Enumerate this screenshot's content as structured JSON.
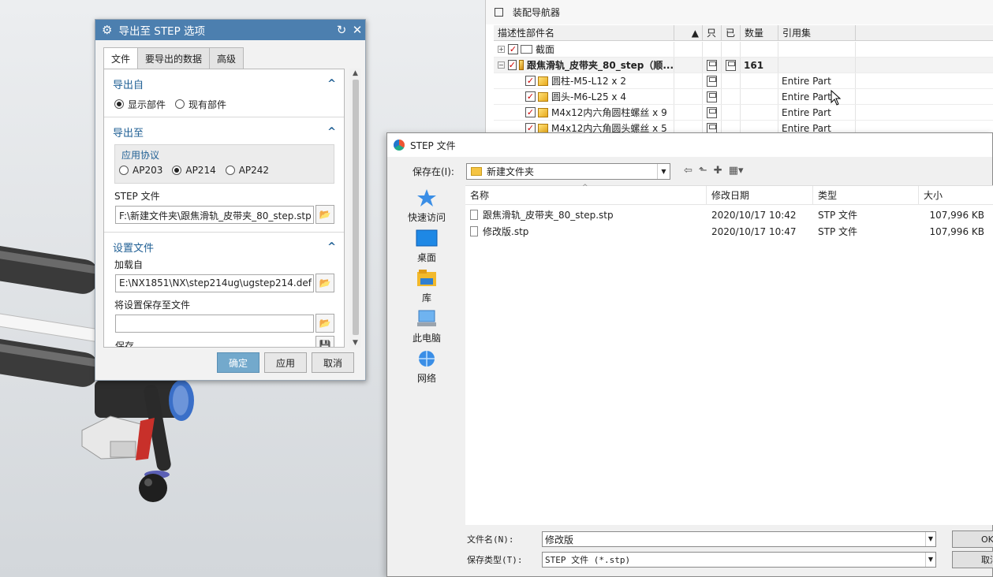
{
  "export_dialog": {
    "title": "导出至 STEP 选项",
    "tabs": [
      "文件",
      "要导出的数据",
      "高级"
    ],
    "export_from": {
      "label": "导出自",
      "options": [
        "显示部件",
        "现有部件"
      ],
      "selected": "显示部件"
    },
    "export_to": {
      "label": "导出至",
      "protocol_label": "应用协议",
      "protocols": [
        "AP203",
        "AP214",
        "AP242"
      ],
      "selected_protocol": "AP214",
      "step_file_label": "STEP 文件",
      "step_file_value": "F:\\新建文件夹\\跟焦滑轨_皮带夹_80_step.stp"
    },
    "settings": {
      "label": "设置文件",
      "load_from_label": "加载自",
      "load_from_value": "E:\\NX1851\\NX\\step214ug\\ugstep214.def",
      "save_to_label": "将设置保存至文件",
      "save_to_value": "",
      "save_label": "保存"
    },
    "buttons": {
      "ok": "确定",
      "apply": "应用",
      "cancel": "取消"
    }
  },
  "assembly_navigator": {
    "title": "装配导航器",
    "columns": [
      "描述性部件名",
      "只",
      "已",
      "数量",
      "引用集"
    ],
    "rows": [
      {
        "name": "截面",
        "qty": "",
        "ref": ""
      },
      {
        "name": "跟焦滑轨_皮带夹_80_step（顺...",
        "qty": "161",
        "ref": ""
      },
      {
        "name": "圆柱-M5-L12 x 2",
        "qty": "",
        "ref": "Entire Part"
      },
      {
        "name": "圆头-M6-L25 x 4",
        "qty": "",
        "ref": "Entire Part"
      },
      {
        "name": "M4x12内六角圆柱螺丝 x 9",
        "qty": "",
        "ref": "Entire Part"
      },
      {
        "name": "M4x12内六角圆头螺丝 x 5",
        "qty": "",
        "ref": "Entire Part"
      }
    ]
  },
  "file_dialog": {
    "title": "STEP 文件",
    "save_in_label": "保存在(I):",
    "save_in_value": "新建文件夹",
    "places": [
      "快速访问",
      "桌面",
      "库",
      "此电脑",
      "网络"
    ],
    "columns": [
      "名称",
      "修改日期",
      "类型",
      "大小"
    ],
    "files": [
      {
        "name": "跟焦滑轨_皮带夹_80_step.stp",
        "date": "2020/10/17 10:42",
        "type": "STP 文件",
        "size": "107,996 KB"
      },
      {
        "name": "修改版.stp",
        "date": "2020/10/17 10:47",
        "type": "STP 文件",
        "size": "107,996 KB"
      }
    ],
    "filename_label": "文件名(N):",
    "filename_value": "修改版",
    "filetype_label": "保存类型(T):",
    "filetype_value": "STEP 文件 (*.stp)",
    "ok_label": "OK",
    "cancel_label": "取消"
  }
}
